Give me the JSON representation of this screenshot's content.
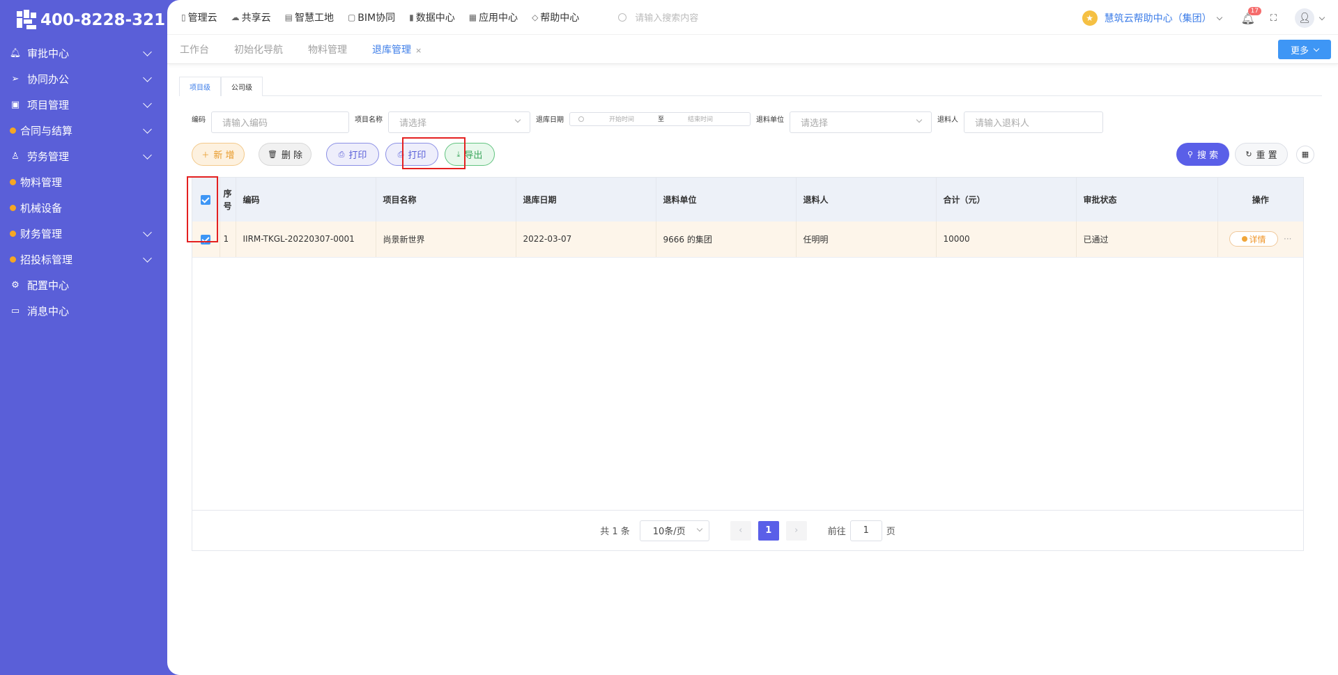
{
  "sidebar": {
    "phone": "400-8228-321",
    "items": [
      {
        "label": "审批中心",
        "icon": "bell-icon",
        "expandable": true
      },
      {
        "label": "协同办公",
        "icon": "send-icon",
        "expandable": true
      },
      {
        "label": "项目管理",
        "icon": "book-icon",
        "expandable": true
      },
      {
        "label": "合同与结算",
        "icon": "dot-icon",
        "expandable": true
      },
      {
        "label": "劳务管理",
        "icon": "worker-icon",
        "expandable": true
      },
      {
        "label": "物料管理",
        "icon": "dot-icon",
        "expandable": false
      },
      {
        "label": "机械设备",
        "icon": "dot-icon",
        "expandable": false
      },
      {
        "label": "财务管理",
        "icon": "dot-icon",
        "expandable": true
      },
      {
        "label": "招投标管理",
        "icon": "dot-icon",
        "expandable": true
      },
      {
        "label": "配置中心",
        "icon": "gear-icon",
        "expandable": false
      },
      {
        "label": "消息中心",
        "icon": "message-icon",
        "expandable": false
      }
    ]
  },
  "topnav": {
    "items": [
      "管理云",
      "共享云",
      "智慧工地",
      "BIM协同",
      "数据中心",
      "应用中心",
      "帮助中心"
    ],
    "search_placeholder": "请输入搜索内容",
    "org_name": "慧筑云帮助中心（集团）",
    "notification_count": "17"
  },
  "page_tabs": {
    "items": [
      "工作台",
      "初始化导航",
      "物料管理",
      "退库管理"
    ],
    "active_index": 3,
    "close_glyph": "×",
    "more_label": "更多"
  },
  "level_tabs": [
    "项目级",
    "公司级"
  ],
  "filters": {
    "code_label": "编码",
    "code_placeholder": "请输入编码",
    "project_label": "项目名称",
    "project_placeholder": "请选择",
    "date_label": "退库日期",
    "date_start_placeholder": "开始时间",
    "date_separator": "至",
    "date_end_placeholder": "结束时间",
    "unit_label": "退料单位",
    "unit_placeholder": "请选择",
    "person_label": "退料人",
    "person_placeholder": "请输入退料人"
  },
  "actions": {
    "add": "新 增",
    "delete": "删 除",
    "print1": "打印",
    "print2": "打印",
    "export": "导出",
    "search": "搜 索",
    "reset": "重 置"
  },
  "table": {
    "headers": [
      "序号",
      "编码",
      "项目名称",
      "退库日期",
      "退料单位",
      "退料人",
      "合计（元）",
      "审批状态",
      "操作"
    ],
    "rows": [
      {
        "index": "1",
        "code": "IIRM-TKGL-20220307-0001",
        "project": "尚景新世界",
        "date": "2022-03-07",
        "unit": "9666 的集团",
        "person": "任明明",
        "total": "10000",
        "status": "已通过",
        "detail_label": "详情",
        "checked": true
      }
    ]
  },
  "pagination": {
    "total_text": "共 1 条",
    "page_size": "10条/页",
    "current_page": "1",
    "goto_label": "前往",
    "goto_value": "1",
    "page_suffix": "页"
  },
  "colors": {
    "sidebar_bg": "#5a5fd8",
    "accent": "#5a5fe8",
    "link_blue": "#3e7ee8",
    "highlight_red": "#e42020"
  }
}
